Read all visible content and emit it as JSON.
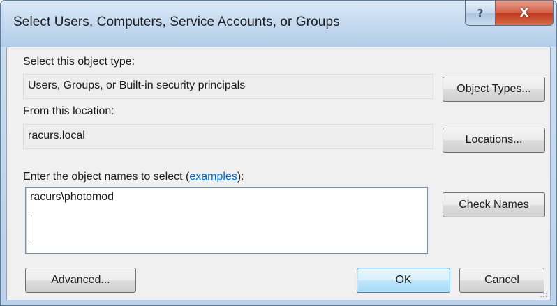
{
  "window": {
    "title": "Select Users, Computers, Service Accounts, or Groups",
    "help_glyph": "?",
    "close_glyph": "X"
  },
  "object_type": {
    "label": "Select this object type:",
    "value": "Users, Groups, or Built-in security principals",
    "button": "Object Types..."
  },
  "location": {
    "label": "From this location:",
    "value": "racurs.local",
    "button": "Locations..."
  },
  "names": {
    "label_access_key": "E",
    "label_rest": "nter the object names to select (",
    "link": "examples",
    "label_end": "):",
    "value": "racurs\\photomod",
    "button": "Check Names"
  },
  "footer": {
    "advanced": "Advanced...",
    "ok": "OK",
    "cancel": "Cancel"
  },
  "colors": {
    "link": "#0066cc",
    "close_button": "#c8472a",
    "default_button_border": "#3c7fb1"
  }
}
